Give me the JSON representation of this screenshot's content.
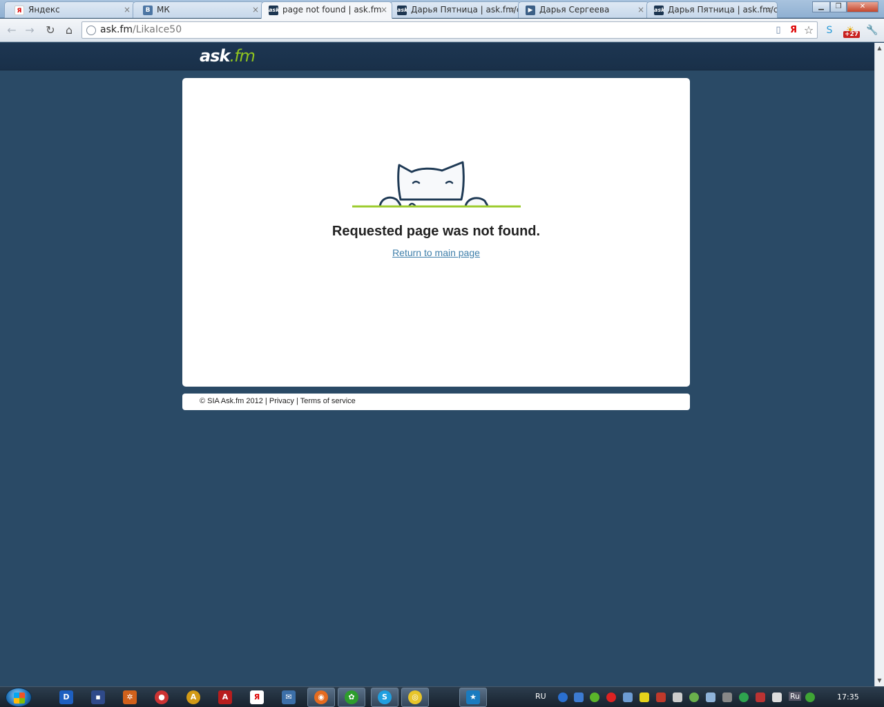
{
  "browser": {
    "tabs": [
      {
        "label": "Яндекс",
        "favicon": "yandex-icon",
        "favicon_text": "Я",
        "active": false
      },
      {
        "label": "МК",
        "favicon": "vk-icon",
        "favicon_text": "В",
        "active": false
      },
      {
        "label": "page not found | ask.fm",
        "favicon": "askfm-icon",
        "favicon_text": "ask",
        "active": true
      },
      {
        "label": "Дарья Пятница | ask.fm/c",
        "favicon": "askfm-icon",
        "favicon_text": "ask",
        "active": false
      },
      {
        "label": "Дарья Сергеева",
        "favicon": "video-icon",
        "favicon_text": "▶",
        "active": false
      },
      {
        "label": "Дарья Пятница | ask.fm/c",
        "favicon": "askfm-icon",
        "favicon_text": "ask",
        "active": false
      }
    ],
    "tab_close_glyph": "×",
    "address": {
      "host": "ask.fm",
      "path": "/LikaIce50"
    },
    "extension_badge": "+27",
    "colors": {
      "tabstrip": "#a9c3de",
      "accent_green": "#8fc31f",
      "page_bg": "#2a4a66"
    }
  },
  "site": {
    "logo_main": "ask",
    "logo_dot_fm": ".fm",
    "error_title": "Requested page was not found.",
    "return_link": "Return to main page",
    "footer": {
      "copyright": "© SIA Ask.fm 2012",
      "sep": " | ",
      "privacy": "Privacy",
      "terms": "Terms of service"
    }
  },
  "taskbar": {
    "language": "RU",
    "ime": "Ru",
    "clock": "17:35"
  }
}
